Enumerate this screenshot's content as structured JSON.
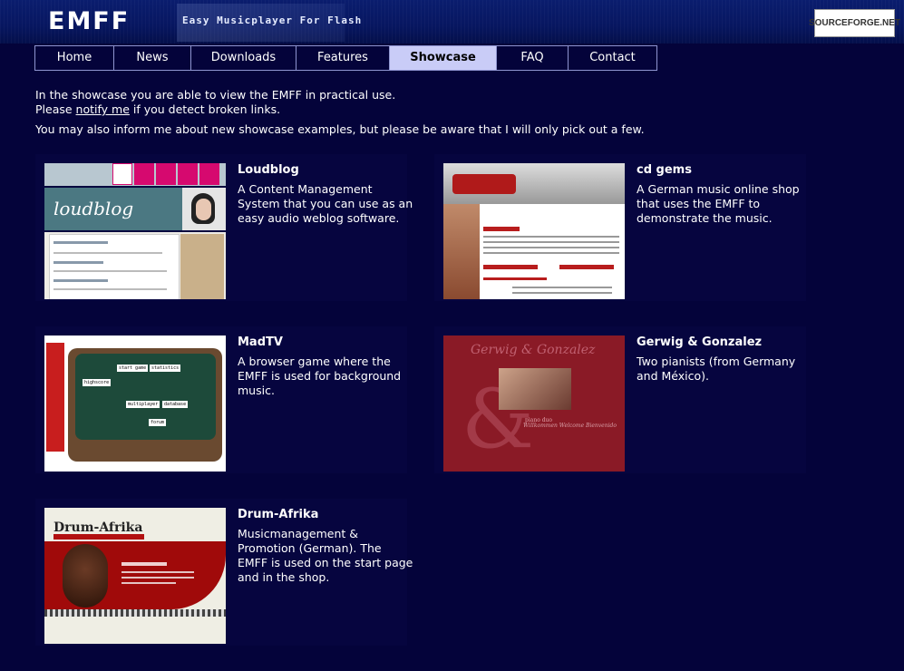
{
  "header": {
    "logo": "EMFF",
    "tagline": "Easy Musicplayer For Flash",
    "sourceforge_badge": "SOURCEFORGE.NET"
  },
  "nav": {
    "tabs": [
      {
        "label": "Home",
        "active": false
      },
      {
        "label": "News",
        "active": false
      },
      {
        "label": "Downloads",
        "active": false
      },
      {
        "label": "Features",
        "active": false
      },
      {
        "label": "Showcase",
        "active": true
      },
      {
        "label": "FAQ",
        "active": false
      },
      {
        "label": "Contact",
        "active": false
      }
    ]
  },
  "intro": {
    "line1": "In the showcase you are able to view the EMFF in practical use.",
    "line2_prefix": "Please ",
    "line2_link": "notify me",
    "line2_suffix": " if you detect broken links.",
    "line3": "You may also inform me about new showcase examples, but please be aware that I will only pick out a few."
  },
  "showcase": [
    {
      "title": "Loudblog",
      "description": "A Content Management System that you can use as an easy audio weblog software."
    },
    {
      "title": "cd gems",
      "description": "A German music online shop that uses the EMFF to demonstrate the music."
    },
    {
      "title": "MadTV",
      "description": "A browser game where the EMFF is used for background music."
    },
    {
      "title": "Gerwig & Gonzalez",
      "description": "Two pianists (from Germany and México)."
    },
    {
      "title": "Drum-Afrika",
      "description": "Musicmanagement & Promotion (German). The EMFF is used on the start page and in the shop."
    }
  ],
  "thumbnails": {
    "loudblog_logo": "loudblog",
    "gerwig_title": "Gerwig & Gonzalez",
    "gerwig_amp": "&",
    "gerwig_sub": "piano duo",
    "gerwig_nav": "Willkommen   Welcome   Bienvenido",
    "drum_logo": "Drum-Afrika",
    "madtv_labels": [
      "start game",
      "statistics",
      "highscore",
      "multiplayer",
      "database",
      "forum"
    ]
  },
  "colors": {
    "background": "#04033a",
    "active_tab": "#c9ccf7",
    "tab_border": "#8f95d0"
  }
}
